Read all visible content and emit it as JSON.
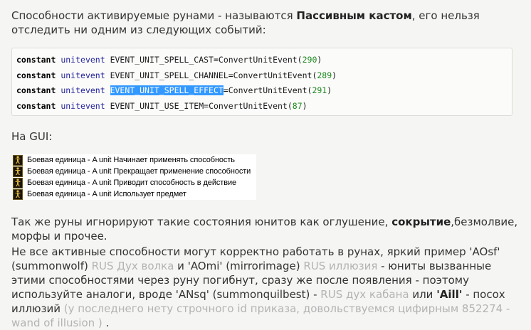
{
  "intro": {
    "before": "Способности активируемые рунами - называются ",
    "bold": "Пассивным кастом",
    "after": ", его нельзя отследить ни одним из следующих событий:"
  },
  "code": {
    "kw": "constant",
    "type": "unitevent",
    "lines": [
      {
        "event": "EVENT_UNIT_SPELL_CAST",
        "func": "=ConvertUnitEvent(",
        "num": "290",
        "close": ")"
      },
      {
        "event": "EVENT_UNIT_SPELL_CHANNEL",
        "func": "=ConvertUnitEvent(",
        "num": "289",
        "close": ")"
      },
      {
        "event": "EVENT_UNIT_SPELL_EFFECT",
        "func": "=ConvertUnitEvent(",
        "num": "291",
        "close": ")"
      },
      {
        "event": "EVENT_UNIT_USE_ITEM",
        "func": "=ConvertUnitEvent(",
        "num": "87",
        "close": ")"
      }
    ]
  },
  "gui_label": "На GUI:",
  "gui_rows": [
    "Боевая единица - A unit Начинает применять способность",
    "Боевая единица - A unit Прекращает применение способности",
    "Боевая единица - A unit Приводит способность в действие",
    "Боевая единица - A unit Использует предмет"
  ],
  "p3": {
    "before": "Так же руны игнорируют такие состояния юнитов как оглушение, ",
    "bold": "сокрытие",
    "after": ",безмолвие, морфы и прочее."
  },
  "p4": {
    "s1": "Не все активные способности могут корректно работать в рунах, яркий пример 'AOsf' (summonwolf) ",
    "g1": "RUS Дух волка",
    "s2": " и 'AOmi' (mirrorimage) ",
    "g2": "RUS иллюзия",
    "s3": " - юниты вызванные этими способностями через руну погибнут, сразу же после появления - поэтому используйте аналоги, вроде 'ANsq' (summonquilbest) - ",
    "g3": "RUS дух кабана",
    "s4": " или ",
    "b1": "'Aill'",
    "s5": " - посох иллюзий ",
    "g4": "(у последнего нету строчного id приказа, довольствуемся цифирным 852274 - wand of illusion )",
    "s6": " ."
  },
  "colors": {
    "text": "#333333",
    "muted": "#b3b3b3",
    "keyword_type": "#23239c",
    "number": "#1d8a1d",
    "selection": "#3399ff"
  },
  "icons": {
    "gui_row": "unit-event-icon"
  }
}
